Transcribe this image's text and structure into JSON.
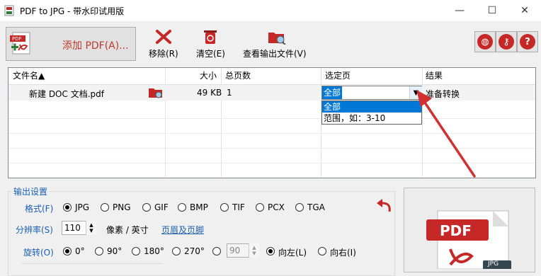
{
  "window": {
    "title": "PDF to JPG - 带水印试用版",
    "minimize": "—",
    "maximize": "☐",
    "close": "✕"
  },
  "toolbar": {
    "add_pdf": "添加 PDF(A)...",
    "remove": "移除(R)",
    "clear": "清空(E)",
    "view_output": "查看输出文件(V)",
    "pdf_badge": "PDF"
  },
  "help_buttons": {
    "globe": "◍",
    "key": "⚷",
    "help": "?"
  },
  "table": {
    "headers": [
      "文件名▲",
      "大小",
      "总页数",
      "选定页",
      "结果"
    ],
    "rows": [
      {
        "filename": "新建 DOC 文档.pdf",
        "size": "49 KB",
        "pages": "1",
        "selected": "全部",
        "result": "准备转换"
      }
    ]
  },
  "dropdown": {
    "options": [
      "全部",
      "范围，如：3-10"
    ],
    "selected_index": 0
  },
  "settings": {
    "title": "输出设置",
    "format_label": "格式(F)",
    "formats": [
      "JPG",
      "PNG",
      "GIF",
      "BMP",
      "TIF",
      "PCX",
      "TGA"
    ],
    "format_selected": "JPG",
    "resolution_label": "分辨率(S)",
    "resolution_value": "110",
    "resolution_unit": "像素 / 英寸",
    "header_footer_link": "页眉及页脚",
    "rotation_label": "旋转(O)",
    "rotations": [
      "0°",
      "90°",
      "180°",
      "270°"
    ],
    "rotation_selected": "0°",
    "custom_angle": "90",
    "rotate_left": "向左(L)",
    "rotate_right": "向右(I)"
  },
  "preview": {
    "badge": "PDF",
    "sub_badge": "JPG"
  },
  "colors": {
    "accent_red": "#c62828",
    "link_blue": "#1a5fb4",
    "selection": "#0078d7"
  }
}
